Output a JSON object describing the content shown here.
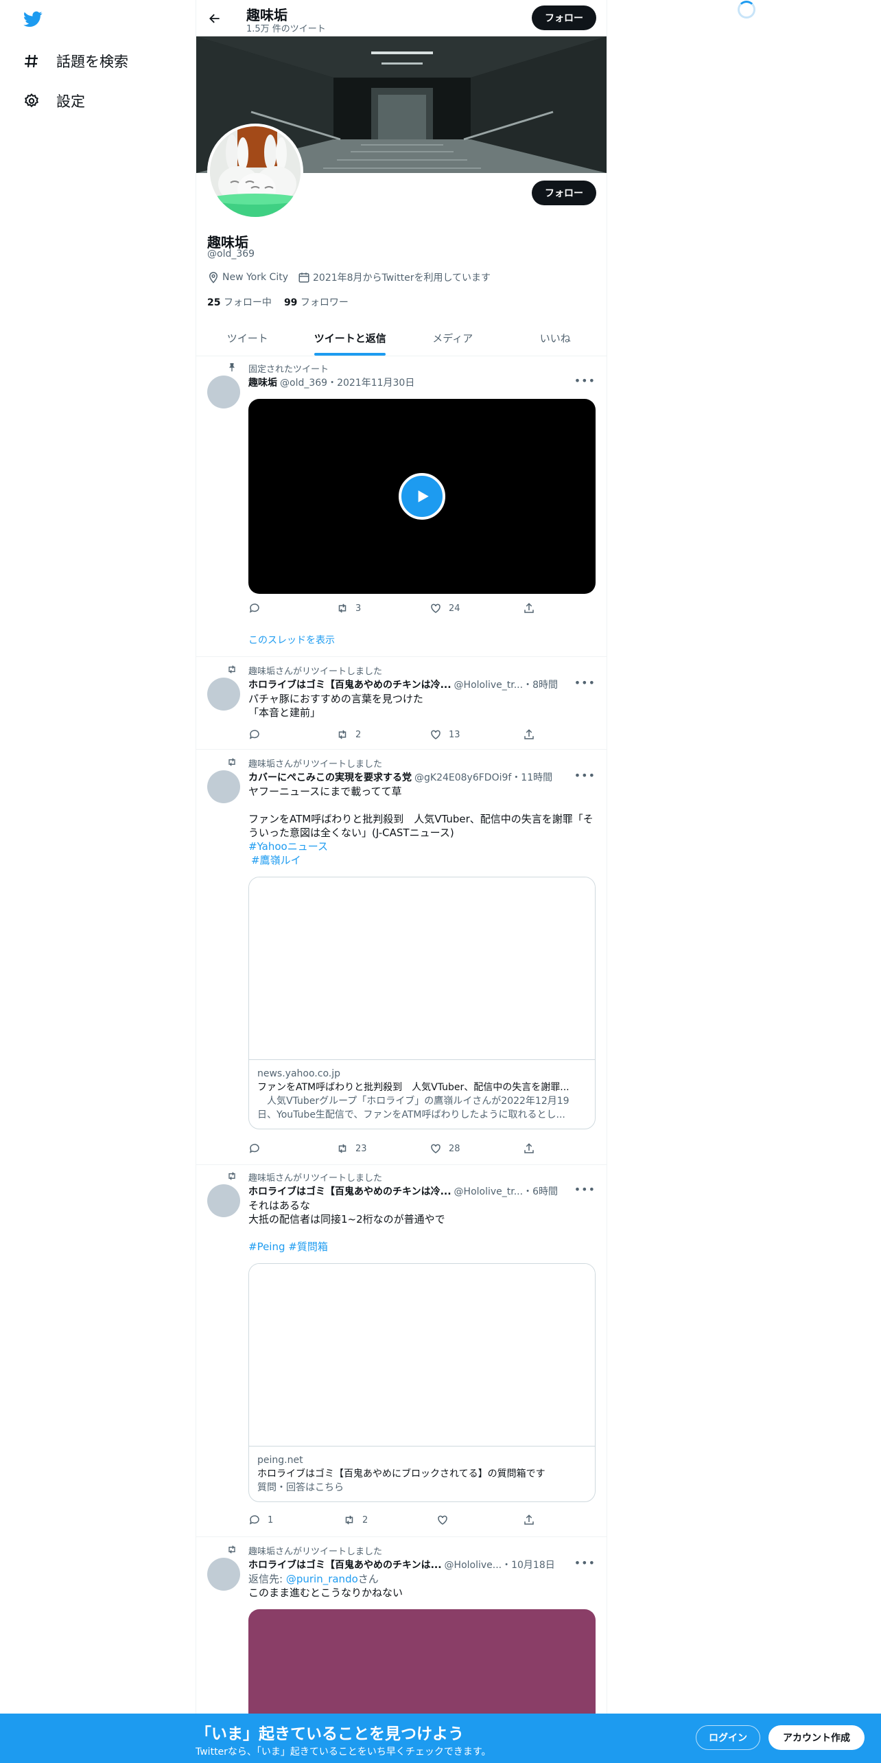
{
  "nav": {
    "explore_label": "話題を検索",
    "settings_label": "設定"
  },
  "header": {
    "name": "趣味垢",
    "tweet_count": "1.5万 件のツイート",
    "follow_label": "フォロー"
  },
  "profile": {
    "name": "趣味垢",
    "handle": "@old_369",
    "location": "New York City",
    "joined": "2021年8月からTwitterを利用しています",
    "following_count": "25",
    "following_label": "フォロー中",
    "followers_count": "99",
    "followers_label": "フォロワー",
    "follow_label": "フォロー"
  },
  "tabs": [
    {
      "label": "ツイート"
    },
    {
      "label": "ツイートと返信"
    },
    {
      "label": "メディア"
    },
    {
      "label": "いいね"
    }
  ],
  "tweets": [
    {
      "context": "固定されたツイート",
      "name": "趣味垢",
      "meta": "@old_369・2021年11月30日",
      "reply": "",
      "retweets": "3",
      "likes": "24",
      "thread_link": "このスレッドを表示"
    },
    {
      "context": "趣味垢さんがリツイートしました",
      "name": "ホロライブはゴミ【百鬼あやめのチキンは冷...",
      "meta": "@Hololive_tr...・8時間",
      "line1": "パチャ豚におすすめの言葉を見つけた",
      "line2": "「本音と建前」",
      "reply": "",
      "retweets": "2",
      "likes": "13"
    },
    {
      "context": "趣味垢さんがリツイートしました",
      "name": "カバーにぺこみこの実現を要求する党",
      "meta": "@gK24E08y6FDOi9f・11時間",
      "line1": "ヤフーニュースにまで載ってて草",
      "line2": "ファンをATM呼ばわりと批判殺到　人気VTuber、配信中の失言を謝罪「そういった意図は全くない」(J-CASTニュース)",
      "tag1": "#Yahooニュース",
      "tag2": "#鷹嶺ルイ",
      "card_domain": "news.yahoo.co.jp",
      "card_title": "ファンをATM呼ばわりと批判殺到　人気VTuber、配信中の失言を謝罪...",
      "card_desc": "　人気VTuberグループ「ホロライブ」の鷹嶺ルイさんが2022年12月19日、YouTube生配信で、ファンをATM呼ばわりしたように取れるとし...",
      "reply": "",
      "retweets": "23",
      "likes": "28"
    },
    {
      "context": "趣味垢さんがリツイートしました",
      "name": "ホロライブはゴミ【百鬼あやめのチキンは冷...",
      "meta": "@Hololive_tr...・6時間",
      "line1": "それはあるな",
      "line2": "大抵の配信者は同接1~2桁なのが普通やで",
      "tag1": "#Peing",
      "tag2": "#質問箱",
      "card_domain": "peing.net",
      "card_title": "ホロライブはゴミ【百鬼あやめにブロックされてる】の質問箱です",
      "card_desc": "質問・回答はこちら",
      "reply": "1",
      "retweets": "2",
      "likes": ""
    },
    {
      "context": "趣味垢さんがリツイートしました",
      "name": "ホロライブはゴミ【百鬼あやめのチキンは...",
      "meta": "@Hololive...・10月18日",
      "reply_to_prefix": "返信先: ",
      "reply_to_handle": "@purin_rando",
      "reply_to_suffix": "さん",
      "line1": "このまま進むとこうなりかねない"
    }
  ],
  "bottom": {
    "title": "「いま」起きていることを見つけよう",
    "subtitle": "Twitterなら、「いま」起きていることをいち早くチェックできます。",
    "login_label": "ログイン",
    "signup_label": "アカウント作成"
  },
  "colors": {
    "accent": "#1d9bf0",
    "dark": "#0f1419",
    "muted": "#536471",
    "media_purple": "#8a3e67"
  }
}
